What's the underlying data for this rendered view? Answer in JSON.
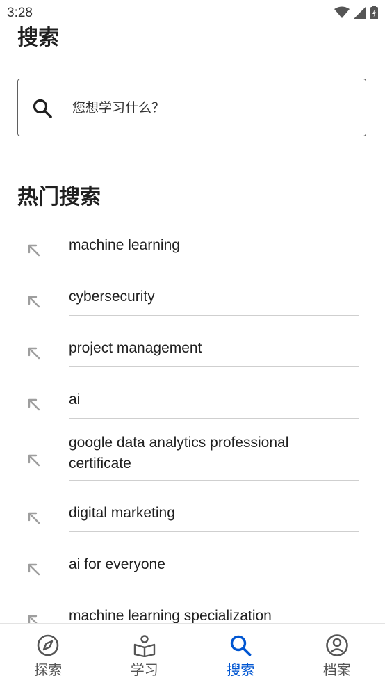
{
  "status_bar": {
    "time": "3:28"
  },
  "page": {
    "title": "搜索"
  },
  "search": {
    "placeholder": "您想学习什么？"
  },
  "popular": {
    "title": "热门搜索",
    "items": [
      {
        "label": "machine learning"
      },
      {
        "label": "cybersecurity"
      },
      {
        "label": "project management"
      },
      {
        "label": "ai"
      },
      {
        "label": "google data analytics professional certificate"
      },
      {
        "label": "digital marketing"
      },
      {
        "label": "ai for everyone"
      },
      {
        "label": "machine learning specialization"
      }
    ]
  },
  "bottom_nav": {
    "items": [
      {
        "label": "探索",
        "icon": "compass-icon"
      },
      {
        "label": "学习",
        "icon": "book-person-icon"
      },
      {
        "label": "搜索",
        "icon": "search-icon",
        "active": true
      },
      {
        "label": "档案",
        "icon": "profile-icon"
      }
    ]
  },
  "colors": {
    "accent": "#0056d2",
    "text": "#1f1f1f",
    "divider": "#cfcfcf",
    "icon_gray": "#9e9e9e"
  }
}
